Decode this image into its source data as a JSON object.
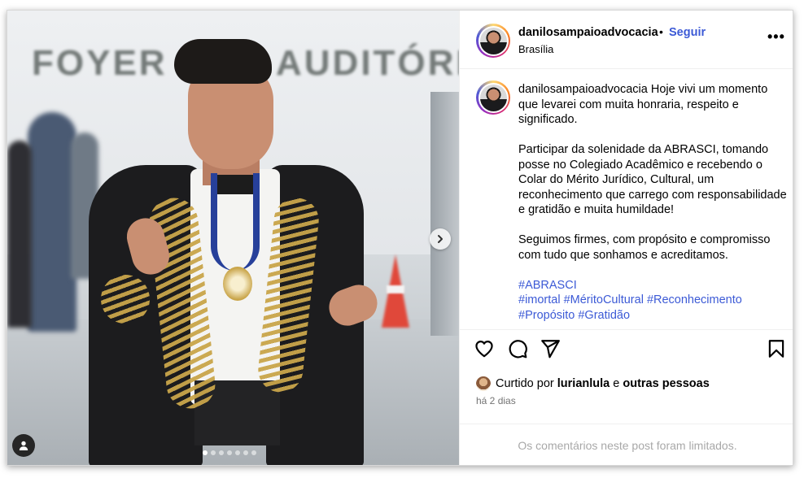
{
  "post": {
    "photo_sign_left": "FOYER",
    "photo_sign_right": "AUDITÓRIO",
    "carousel_total": 7,
    "carousel_active": 0
  },
  "header": {
    "username": "danilosampaioadvocacia",
    "separator": "•",
    "follow_label": "Seguir",
    "location": "Brasília",
    "more_label": "•••"
  },
  "caption": {
    "username": "danilosampaioadvocacia",
    "paragraph1": "Hoje vivi um momento que levarei com muita honraria, respeito e significado.",
    "paragraph2": "Participar da solenidade da ABRASCI, tomando posse no Colegiado Acadêmico e recebendo o Colar do Mérito Jurídico, Cultural, um reconhecimento que carrego com responsabilidade e gratidão e muita humildade!",
    "paragraph3": "Seguimos firmes, com propósito e compromisso com tudo que sonhamos e acreditamos.",
    "hashtags_line1": "#ABRASCI",
    "hashtags_line2": "#imortal #MéritoCultural #Reconhecimento",
    "hashtags_line3": "#Propósito #Gratidão"
  },
  "actions": {
    "icons": [
      "heart-icon",
      "comment-icon",
      "share-icon",
      "bookmark-icon"
    ]
  },
  "likes": {
    "prefix": "Curtido por",
    "user": "lurianlula",
    "conjunction": "e",
    "others": "outras pessoas"
  },
  "timestamp": "há 2 dias",
  "comments_notice": "Os comentários neste post foram limitados.",
  "colors": {
    "link_blue": "#3c5ad6",
    "muted_gray": "#737373",
    "notice_gray": "#a8a8a8"
  }
}
